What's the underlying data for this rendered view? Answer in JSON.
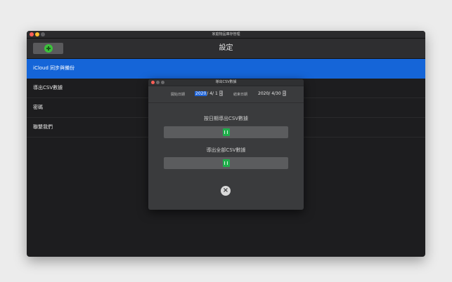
{
  "window": {
    "title": "家庭物品庫存管理"
  },
  "header": {
    "title": "設定",
    "add_button_icon": "plus-circle-icon"
  },
  "menu": {
    "items": [
      {
        "label": "iCloud 同步與備份",
        "selected": true
      },
      {
        "label": "導出CSV數據",
        "selected": false
      },
      {
        "label": "密碼",
        "selected": false
      },
      {
        "label": "聯繫我們",
        "selected": false
      }
    ]
  },
  "dialog": {
    "title": "導出CSV數據",
    "start_label": "開始日期",
    "start_year": "2020",
    "start_rest": "/  4/  1",
    "end_label": "結束日期",
    "end_date": "2020/  4/30",
    "export_by_date_label": "按日期導出CSV數據",
    "export_all_label": "導出全部CSV數據",
    "export_icon": "excel-icon",
    "close_icon": "close-icon"
  },
  "colors": {
    "selected": "#1565d8",
    "accent_green": "#3cc13b",
    "excel_green": "#1fae4b"
  }
}
